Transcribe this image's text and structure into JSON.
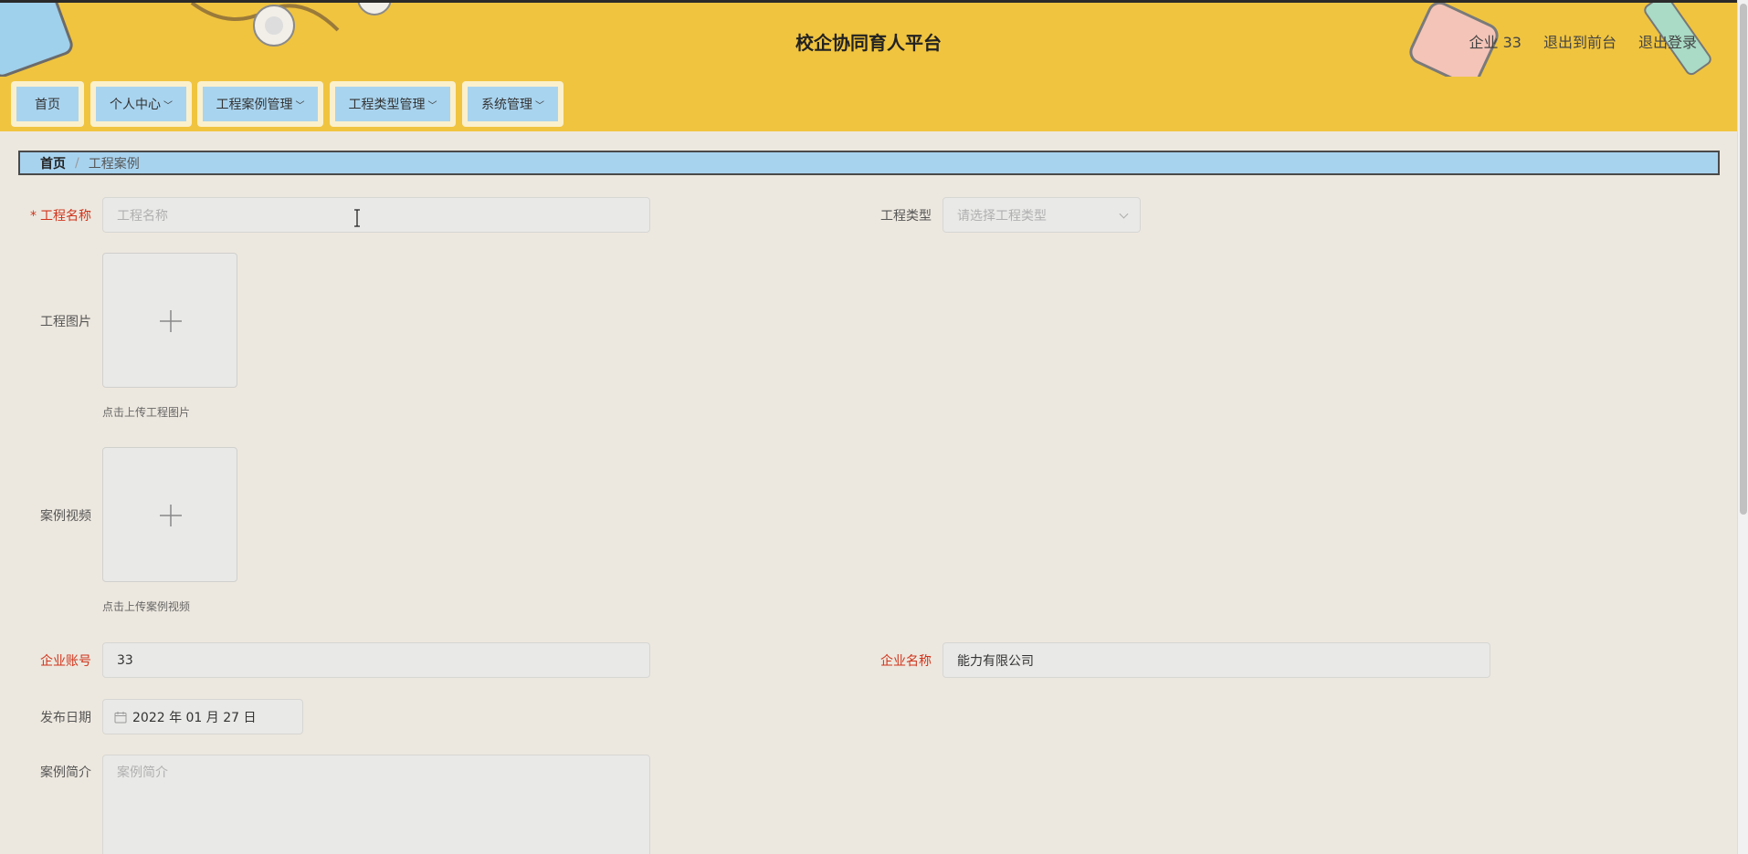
{
  "header": {
    "title": "校企协同育人平台",
    "user_label": "企业 33",
    "exit_front": "退出到前台",
    "logout": "退出登录"
  },
  "nav": [
    {
      "label": "首页",
      "has_dropdown": false
    },
    {
      "label": "个人中心",
      "has_dropdown": true
    },
    {
      "label": "工程案例管理",
      "has_dropdown": true
    },
    {
      "label": "工程类型管理",
      "has_dropdown": true
    },
    {
      "label": "系统管理",
      "has_dropdown": true
    }
  ],
  "breadcrumb": {
    "home": "首页",
    "separator": "/",
    "current": "工程案例"
  },
  "form": {
    "project_name": {
      "label": "工程名称",
      "required": true,
      "placeholder": "工程名称",
      "value": ""
    },
    "project_type": {
      "label": "工程类型",
      "placeholder": "请选择工程类型",
      "value": ""
    },
    "project_image": {
      "label": "工程图片",
      "hint": "点击上传工程图片"
    },
    "case_video": {
      "label": "案例视频",
      "hint": "点击上传案例视频"
    },
    "company_account": {
      "label": "企业账号",
      "value": "33"
    },
    "company_name": {
      "label": "企业名称",
      "value": "能力有限公司"
    },
    "publish_date": {
      "label": "发布日期",
      "value": "2022 年 01 月 27 日"
    },
    "case_intro": {
      "label": "案例简介",
      "placeholder": "案例简介",
      "value": ""
    }
  },
  "colors": {
    "header_bg": "#f0c43f",
    "nav_button_bg": "#a9d4ef",
    "page_bg": "#ede8df",
    "required_label": "#d0341c"
  }
}
